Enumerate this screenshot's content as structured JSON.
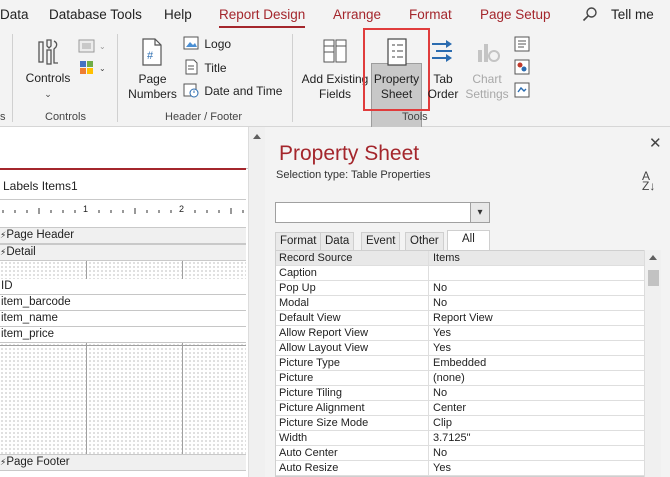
{
  "menu": {
    "tabs": [
      {
        "label": "Data"
      },
      {
        "label": "Database Tools"
      },
      {
        "label": "Help"
      },
      {
        "label": "Report Design"
      },
      {
        "label": "Arrange"
      },
      {
        "label": "Format"
      },
      {
        "label": "Page Setup"
      }
    ],
    "tell_me": "Tell me"
  },
  "ribbon": {
    "groups": {
      "left_partial": "s",
      "controls": "Controls",
      "header_footer": "Header / Footer",
      "tools": "Tools"
    },
    "controls_button": "Controls",
    "page_numbers_line1": "Page",
    "page_numbers_line2": "Numbers",
    "logo": "Logo",
    "title": "Title",
    "date_time": "Date and Time",
    "add_existing_line1": "Add Existing",
    "add_existing_line2": "Fields",
    "property_sheet_line1": "Property",
    "property_sheet_line2": "Sheet",
    "tab_order_line1": "Tab",
    "tab_order_line2": "Order",
    "chart_settings_line1": "Chart",
    "chart_settings_line2": "Settings",
    "accent_color": "#a4262c",
    "highlight_color": "#e03c3c"
  },
  "design": {
    "tab_title": "Labels Items1",
    "ruler_marks": [
      "1",
      "2"
    ],
    "page_header": "Page Header",
    "detail": "Detail",
    "fields": [
      "ID",
      "item_barcode",
      "item_name",
      "item_price"
    ],
    "page_footer": "Page Footer"
  },
  "property_sheet": {
    "title": "Property Sheet",
    "selection_type": "Selection type:  Table Properties",
    "combo_value": "",
    "tabs": [
      {
        "label": "Format"
      },
      {
        "label": "Data"
      },
      {
        "label": "Event"
      },
      {
        "label": "Other"
      },
      {
        "label": "All"
      }
    ],
    "selected_tab": "All",
    "rows": [
      {
        "key": "Record Source",
        "value": "Items"
      },
      {
        "key": "Caption",
        "value": ""
      },
      {
        "key": "Pop Up",
        "value": "No"
      },
      {
        "key": "Modal",
        "value": "No"
      },
      {
        "key": "Default View",
        "value": "Report View"
      },
      {
        "key": "Allow Report View",
        "value": "Yes"
      },
      {
        "key": "Allow Layout View",
        "value": "Yes"
      },
      {
        "key": "Picture Type",
        "value": "Embedded"
      },
      {
        "key": "Picture",
        "value": "(none)"
      },
      {
        "key": "Picture Tiling",
        "value": "No"
      },
      {
        "key": "Picture Alignment",
        "value": "Center"
      },
      {
        "key": "Picture Size Mode",
        "value": "Clip"
      },
      {
        "key": "Width",
        "value": "3.7125\""
      },
      {
        "key": "Auto Center",
        "value": "No"
      },
      {
        "key": "Auto Resize",
        "value": "Yes"
      }
    ]
  },
  "icons": {
    "close": "close-icon",
    "sort": "sort-az-icon",
    "search": "search-icon"
  }
}
